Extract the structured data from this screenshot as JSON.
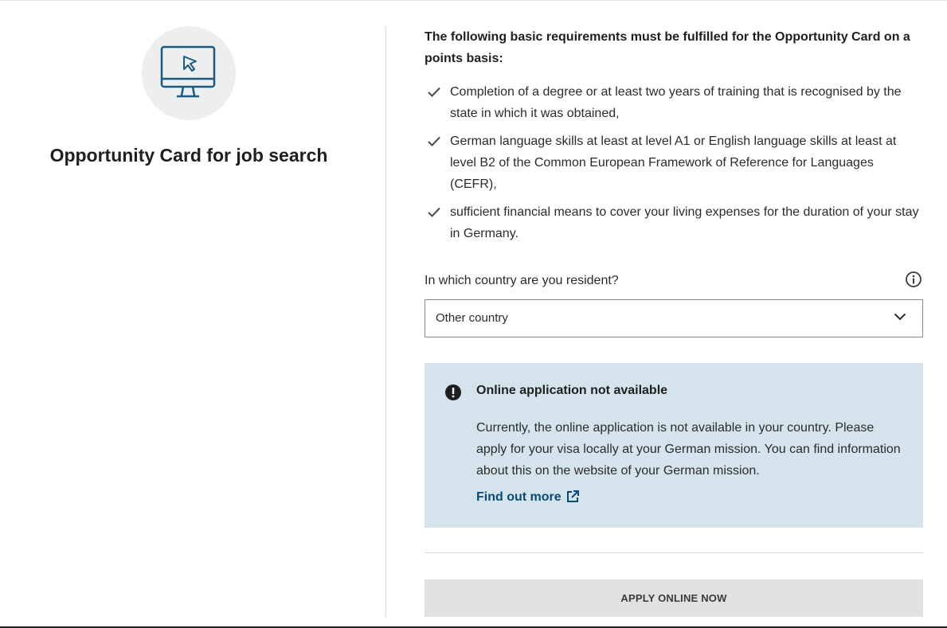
{
  "left": {
    "icon": "computer-cursor-icon",
    "title": "Opportunity Card for job search"
  },
  "requirements": {
    "heading": "The following basic requirements must be fulfilled for the Opportunity Card on a points basis:",
    "items": [
      "Completion of a degree or at least two years of training that is recognised by the state in which it was obtained,",
      "German language skills at least at level A1 or English language skills at least at level B2 of the Common European Framework of Reference for Languages (CEFR),",
      "sufficient financial means to cover your living expenses for the duration of your stay in Germany."
    ]
  },
  "country": {
    "label": "In which country are you resident?",
    "selected": "Other country"
  },
  "notice": {
    "title": "Online application not available",
    "body": "Currently, the online application is not available in your country. Please apply for your visa locally at your German mission. You can find information about this on the website of your German mission.",
    "link": "Find out more",
    "background": "#d5e4ec"
  },
  "apply_button": "APPLY ONLINE NOW",
  "colors": {
    "accent": "#0b4a75",
    "icon_blue": "#1d5a82"
  }
}
